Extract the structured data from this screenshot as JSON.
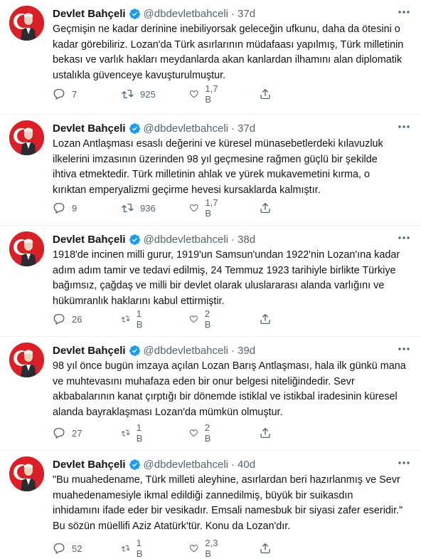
{
  "colors": {
    "accent": "#1d9bf0",
    "muted": "#536471",
    "text": "#0f1419",
    "avatar_bg": "#d92027"
  },
  "icons": {
    "reply": "reply-icon",
    "retweet": "retweet-icon",
    "like": "heart-icon",
    "share": "share-icon",
    "verified": "verified-badge-icon",
    "more": "more-options-icon"
  },
  "tweets": [
    {
      "name": "Devlet Bahçeli",
      "handle": "@dbdevletbahceli",
      "dot": "·",
      "time": "37d",
      "lines": [
        "Geçmişin ne kadar derinine inebiliyorsak geleceğin ufkunu, daha da ötesini o",
        "kadar görebiliriz. Lozan'da Türk asırlarının müdafaası yapılmış, Türk milletinin",
        "bekası ve varlık hakları meydanlarda akan kanlardan ilhamını alan diplomatik",
        "ustalıkla güvenceye kavuşturulmuştur."
      ],
      "replies": "7",
      "retweets": "925",
      "likes": "1,7 B"
    },
    {
      "name": "Devlet Bahçeli",
      "handle": "@dbdevletbahceli",
      "dot": "·",
      "time": "37d",
      "lines": [
        "Lozan Antlaşması esaslı değerini ve küresel münasebetlerdeki kılavuzluk",
        "ilkelerini imzasının üzerinden 98 yıl geçmesine rağmen güçlü bir şekilde",
        "ihtiva etmektedir. Türk milletinin ahlak ve yürek mukavemetini kırma, o",
        "kırıktan emperyalizmi geçirme hevesi kursaklarda kalmıştır."
      ],
      "replies": "9",
      "retweets": "936",
      "likes": "1,7 B"
    },
    {
      "name": "Devlet Bahçeli",
      "handle": "@dbdevletbahceli",
      "dot": "·",
      "time": "38d",
      "lines": [
        "1918'de incinen milli gurur, 1919'un Samsun'undan 1922'nin Lozan'ına kadar",
        "adım adım tamir ve tedavi edilmiş, 24 Temmuz 1923 tarihiyle birlikte Türkiye",
        "bağımsız, çağdaş ve milli bir devlet olarak uluslararası alanda varlığını ve",
        "hükümranlık haklarını kabul ettirmiştir."
      ],
      "replies": "26",
      "retweets": "1 B",
      "likes": "2 B"
    },
    {
      "name": "Devlet Bahçeli",
      "handle": "@dbdevletbahceli",
      "dot": "·",
      "time": "39d",
      "lines": [
        "98 yıl önce bugün imzaya açılan Lozan Barış Antlaşması, hala ilk günkü mana",
        "ve muhtevasını muhafaza eden bir onur belgesi niteliğindedir. Sevr",
        "akbabalarının kanat çırptığı bir dönemde istiklal ve istikbal iradesinin küresel",
        "alanda bayraklaşması Lozan'da mümkün olmuştur."
      ],
      "replies": "27",
      "retweets": "1 B",
      "likes": "2 B"
    },
    {
      "name": "Devlet Bahçeli",
      "handle": "@dbdevletbahceli",
      "dot": "·",
      "time": "40d",
      "lines": [
        "\"Bu muahedename, Türk milleti aleyhine, asırlardan beri hazırlanmış ve Sevr",
        "muahedenamesiyle ikmal edildiği zannedilmiş, büyük bir suikasdın",
        "inhidamını ifade eder bir vesikadır. Emsali namesbuk bir siyasi zafer eseridir.\"",
        "Bu sözün müellifi Aziz Atatürk'tür. Konu da Lozan'dır."
      ],
      "replies": "52",
      "retweets": "1 B",
      "likes": "2,3 B"
    }
  ]
}
